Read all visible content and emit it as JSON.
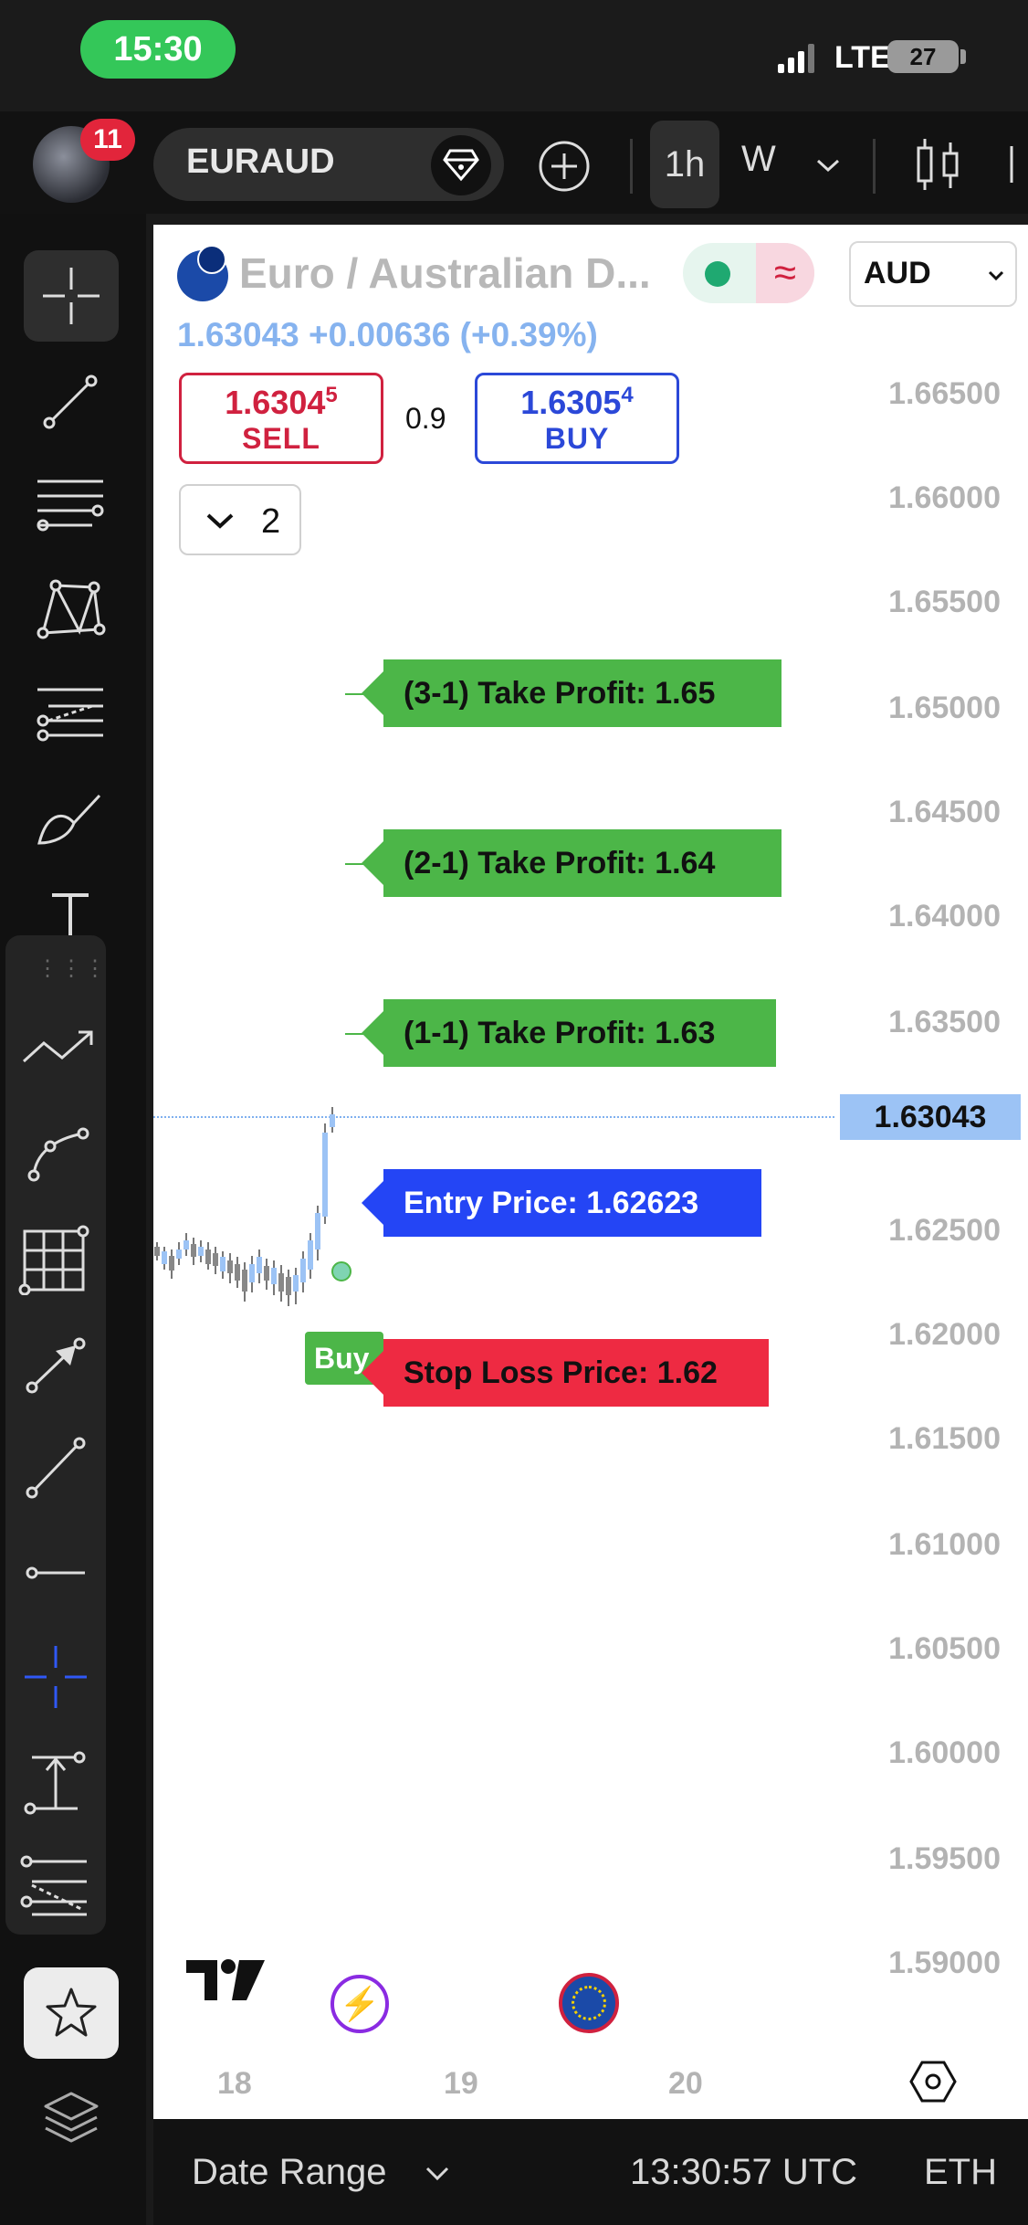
{
  "status_bar": {
    "time": "15:30",
    "network": "LTE",
    "battery": "27"
  },
  "toolbar": {
    "notifications": "11",
    "symbol": "EURAUD",
    "interval": "1h",
    "interval_alt": "W"
  },
  "header": {
    "title": "Euro / Australian D...",
    "currency": "AUD",
    "price_line": "1.63043 +0.00636 (+0.39%)",
    "sell_price": "1.63045",
    "sell_price_main": "1.6304",
    "sell_price_sup": "5",
    "sell_label": "SELL",
    "spread": "0.9",
    "buy_price_main": "1.6305",
    "buy_price_sup": "4",
    "buy_label": "BUY",
    "orders_count": "2"
  },
  "price_axis": [
    "1.66500",
    "1.66000",
    "1.65500",
    "1.65000",
    "1.64500",
    "1.64000",
    "1.63500",
    "1.62500",
    "1.62000",
    "1.61500",
    "1.61000",
    "1.60500",
    "1.60000",
    "1.59500",
    "1.59000"
  ],
  "current_price": "1.63043",
  "date_axis": [
    "18",
    "19",
    "20"
  ],
  "orders": {
    "tp3": "(3-1) Take Profit: 1.65",
    "tp2": "(2-1) Take Profit: 1.64",
    "tp1": "(1-1) Take Profit: 1.63",
    "entry": "Entry Price: 1.62623",
    "stop": "Stop Loss Price: 1.62",
    "buy_marker": "Buy"
  },
  "bottom_bar": {
    "date_range": "Date Range",
    "clock": "13:30:57 UTC",
    "exchange": "ETH"
  },
  "colors": {
    "sell": "#d0213f",
    "buy": "#2b48d8",
    "take_profit": "#4cb648",
    "entry": "#2445f5",
    "stop_loss": "#ee2a42",
    "last_price": "#9cc3f5"
  },
  "icons": [
    "crosshair-icon",
    "trend-line-icon",
    "parallel-channel-icon",
    "pattern-icon",
    "fib-icon",
    "brush-icon",
    "text-icon",
    "path-icon",
    "curve-icon",
    "grid-icon",
    "arrow-icon",
    "ray-icon",
    "horizontal-line-icon",
    "crosshair-blue-icon",
    "measure-icon",
    "regression-icon",
    "star-icon",
    "layers-icon"
  ]
}
